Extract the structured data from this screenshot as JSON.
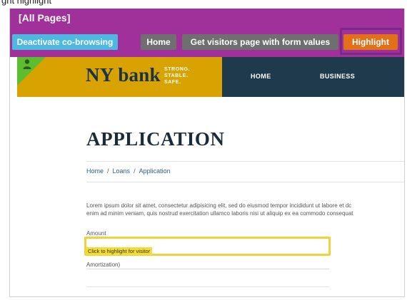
{
  "top_sliver": {
    "text": "ght highlight"
  },
  "cobrowse": {
    "title": "[All Pages]",
    "buttons": {
      "deactivate": "Deactivate co-browsing",
      "home": "Home",
      "get_visitors": "Get visitors page with form values",
      "highlight": "Highlight"
    }
  },
  "site": {
    "logo": "NY bank",
    "tagline": [
      "STRONG.",
      "STABLE.",
      "SAFE."
    ],
    "nav": [
      "HOME",
      "BUSINESS"
    ]
  },
  "content": {
    "title": "APPLICATION",
    "breadcrumb": [
      "Home",
      "Loans",
      "Application"
    ],
    "breadcrumb_sep": "/",
    "lorem": [
      "Lorem ipsum dolor sit amet, consectetur adipisicing elit, sed do eiusmod tempor incididunt ut labore et dc",
      "enim ad minim veniam, quis nostrud exercitation ullamco laboris nisi ut aliquip ex ea commodo consequat"
    ],
    "fields": {
      "amount_label": "Amount",
      "amount_hint": "Click to highlight for visitor",
      "amortization_label": "Amortization)"
    }
  },
  "colors": {
    "cobrowse_bar": "#a0309a",
    "deactivate": "#4db9e0",
    "gray_button": "#6f6f6f",
    "highlight_button": "#e27018",
    "header_gold": "#d8a300",
    "nav_navy": "#1f3a4d",
    "corner_green": "#5cbd2e",
    "focus_yellow": "#f0d23a"
  },
  "icons": {
    "corner": "user-icon"
  }
}
